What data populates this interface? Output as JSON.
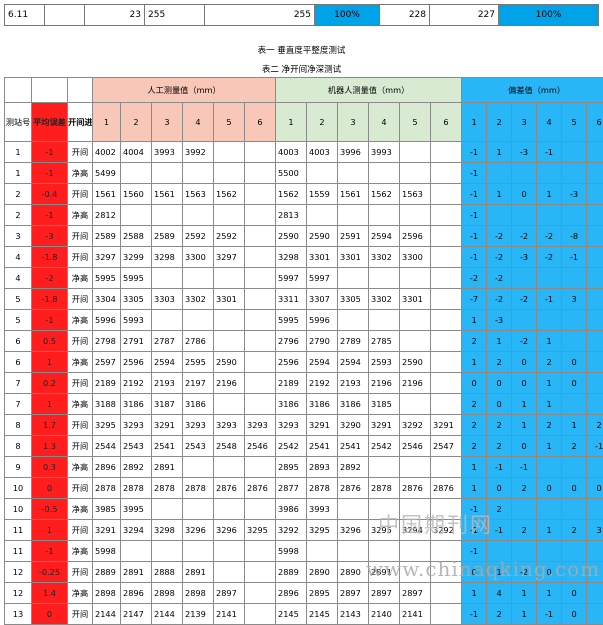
{
  "top_row": [
    "6.11",
    "",
    "23",
    "255",
    "255",
    "100%",
    "228",
    "227",
    "100%"
  ],
  "marks": {
    "center": "",
    "right": "",
    "cell": ""
  },
  "captions": [
    "表一 垂直度平整度测试",
    "表二 净开间净深测试"
  ],
  "header": {
    "manual": "人工测量值（mm）",
    "robot": "机器人测量值（mm）",
    "dev": "偏差值（mm）",
    "station": "测站号",
    "avgdev": "平均误差",
    "type": "开间进深",
    "idx": [
      "1",
      "2",
      "3",
      "4",
      "5",
      "6"
    ]
  },
  "rows": [
    {
      "s": "1",
      "d": "-1",
      "t": "开间",
      "m": [
        "4002",
        "4004",
        "3993",
        "3992",
        "",
        ""
      ],
      "r": [
        "4003",
        "4003",
        "3996",
        "3993",
        "",
        ""
      ],
      "dv": [
        "-1",
        "1",
        "-3",
        "-1",
        "",
        ""
      ]
    },
    {
      "s": "1",
      "d": "-1",
      "t": "净高",
      "m": [
        "5499",
        "",
        "",
        "",
        "",
        ""
      ],
      "r": [
        "5500",
        "",
        "",
        "",
        "",
        ""
      ],
      "dv": [
        "-1",
        "",
        "",
        "",
        "",
        ""
      ]
    },
    {
      "s": "2",
      "d": "-0.4",
      "t": "开间",
      "m": [
        "1561",
        "1560",
        "1561",
        "1563",
        "1562",
        ""
      ],
      "r": [
        "1562",
        "1559",
        "1561",
        "1562",
        "1563",
        ""
      ],
      "dv": [
        "-1",
        "1",
        "0",
        "1",
        "-3",
        ""
      ]
    },
    {
      "s": "2",
      "d": "-1",
      "t": "净高",
      "m": [
        "2812",
        "",
        "",
        "",
        "",
        ""
      ],
      "r": [
        "2813",
        "",
        "",
        "",
        "",
        ""
      ],
      "dv": [
        "-1",
        "",
        "",
        "",
        "",
        ""
      ]
    },
    {
      "s": "3",
      "d": "-3",
      "t": "开间",
      "m": [
        "2589",
        "2588",
        "2589",
        "2592",
        "2592",
        ""
      ],
      "r": [
        "2590",
        "2590",
        "2591",
        "2594",
        "2596",
        ""
      ],
      "dv": [
        "-1",
        "-2",
        "-2",
        "-2",
        "-8",
        ""
      ]
    },
    {
      "s": "4",
      "d": "-1.8",
      "t": "开间",
      "m": [
        "3297",
        "3299",
        "3298",
        "3300",
        "3297",
        ""
      ],
      "r": [
        "3298",
        "3301",
        "3301",
        "3302",
        "3300",
        ""
      ],
      "dv": [
        "-1",
        "-2",
        "-3",
        "-2",
        "-1",
        ""
      ]
    },
    {
      "s": "4",
      "d": "-2",
      "t": "净高",
      "m": [
        "5995",
        "5995",
        "",
        "",
        "",
        ""
      ],
      "r": [
        "5997",
        "5997",
        "",
        "",
        "",
        ""
      ],
      "dv": [
        "-2",
        "-2",
        "",
        "",
        "",
        ""
      ]
    },
    {
      "s": "5",
      "d": "-1.8",
      "t": "开间",
      "m": [
        "3304",
        "3305",
        "3303",
        "3302",
        "3301",
        ""
      ],
      "r": [
        "3311",
        "3307",
        "3305",
        "3302",
        "3301",
        ""
      ],
      "dv": [
        "-7",
        "-2",
        "-2",
        "-1",
        "3",
        ""
      ]
    },
    {
      "s": "5",
      "d": "-1",
      "t": "净高",
      "m": [
        "5996",
        "5993",
        "",
        "",
        "",
        ""
      ],
      "r": [
        "5995",
        "5996",
        "",
        "",
        "",
        ""
      ],
      "dv": [
        "1",
        "-3",
        "",
        "",
        "",
        ""
      ]
    },
    {
      "s": "6",
      "d": "0.5",
      "t": "开间",
      "m": [
        "2798",
        "2791",
        "2787",
        "2786",
        "",
        ""
      ],
      "r": [
        "2796",
        "2790",
        "2789",
        "2785",
        "",
        ""
      ],
      "dv": [
        "2",
        "1",
        "-2",
        "1",
        "",
        ""
      ]
    },
    {
      "s": "6",
      "d": "1",
      "t": "净高",
      "m": [
        "2597",
        "2596",
        "2594",
        "2595",
        "2590",
        ""
      ],
      "r": [
        "2596",
        "2594",
        "2594",
        "2593",
        "2590",
        ""
      ],
      "dv": [
        "1",
        "2",
        "0",
        "2",
        "0",
        ""
      ]
    },
    {
      "s": "7",
      "d": "0.2",
      "t": "开间",
      "m": [
        "2189",
        "2192",
        "2193",
        "2197",
        "2196",
        ""
      ],
      "r": [
        "2189",
        "2192",
        "2193",
        "2196",
        "2196",
        ""
      ],
      "dv": [
        "0",
        "0",
        "0",
        "1",
        "0",
        ""
      ]
    },
    {
      "s": "7",
      "d": "1",
      "t": "净高",
      "m": [
        "3188",
        "3186",
        "3187",
        "3186",
        "",
        ""
      ],
      "r": [
        "3186",
        "3186",
        "3186",
        "3185",
        "",
        ""
      ],
      "dv": [
        "2",
        "0",
        "1",
        "1",
        "",
        ""
      ]
    },
    {
      "s": "8",
      "d": "1.7",
      "t": "开间",
      "m": [
        "3295",
        "3293",
        "3291",
        "3293",
        "3293",
        "3293"
      ],
      "r": [
        "3293",
        "3291",
        "3290",
        "3291",
        "3292",
        "3291"
      ],
      "dv": [
        "2",
        "2",
        "1",
        "2",
        "1",
        "2"
      ]
    },
    {
      "s": "8",
      "d": "1.3",
      "t": "开间",
      "m": [
        "2544",
        "2543",
        "2541",
        "2543",
        "2548",
        "2546"
      ],
      "r": [
        "2542",
        "2541",
        "2541",
        "2542",
        "2546",
        "2547"
      ],
      "dv": [
        "2",
        "2",
        "0",
        "1",
        "2",
        "-1"
      ]
    },
    {
      "s": "9",
      "d": "0.3",
      "t": "净高",
      "m": [
        "2896",
        "2892",
        "2891",
        "",
        "",
        ""
      ],
      "r": [
        "2895",
        "2893",
        "2892",
        "",
        "",
        ""
      ],
      "dv": [
        "1",
        "-1",
        "-1",
        "",
        "",
        ""
      ]
    },
    {
      "s": "10",
      "d": "0",
      "t": "开间",
      "m": [
        "2878",
        "2878",
        "2878",
        "2878",
        "2876",
        "2876"
      ],
      "r": [
        "2877",
        "2878",
        "2876",
        "2878",
        "2876",
        "2876"
      ],
      "dv": [
        "1",
        "0",
        "2",
        "0",
        "0",
        "0"
      ]
    },
    {
      "s": "10",
      "d": "-0.5",
      "t": "净高",
      "m": [
        "3985",
        "3995",
        "",
        "",
        "",
        ""
      ],
      "r": [
        "3986",
        "3993",
        "",
        "",
        "",
        ""
      ],
      "dv": [
        "-1",
        "2",
        "",
        "",
        "",
        ""
      ]
    },
    {
      "s": "11",
      "d": "1",
      "t": "开间",
      "m": [
        "3291",
        "3294",
        "3298",
        "3296",
        "3296",
        "3295"
      ],
      "r": [
        "3292",
        "3295",
        "3296",
        "3295",
        "3294",
        "3292"
      ],
      "dv": [
        "-1",
        "-1",
        "2",
        "1",
        "2",
        "3"
      ]
    },
    {
      "s": "11",
      "d": "-1",
      "t": "净高",
      "m": [
        "5998",
        "",
        "",
        "",
        "",
        ""
      ],
      "r": [
        "5998",
        "",
        "",
        "",
        "",
        ""
      ],
      "dv": [
        "-1",
        "",
        "",
        "",
        "",
        ""
      ]
    },
    {
      "s": "12",
      "d": "-0.25",
      "t": "开间",
      "m": [
        "2889",
        "2891",
        "2888",
        "2891",
        "",
        ""
      ],
      "r": [
        "2889",
        "2890",
        "2890",
        "2891",
        "",
        ""
      ],
      "dv": [
        "0",
        "1",
        "-2",
        "0",
        "",
        ""
      ]
    },
    {
      "s": "12",
      "d": "1.4",
      "t": "净高",
      "m": [
        "2898",
        "2896",
        "2898",
        "2898",
        "2897",
        ""
      ],
      "r": [
        "2896",
        "2895",
        "2897",
        "2897",
        "2897",
        ""
      ],
      "dv": [
        "1",
        "4",
        "1",
        "1",
        "0",
        ""
      ]
    },
    {
      "s": "13",
      "d": "0",
      "t": "开间",
      "m": [
        "2144",
        "2147",
        "2144",
        "2139",
        "2141",
        ""
      ],
      "r": [
        "2145",
        "2145",
        "2143",
        "2140",
        "2141",
        ""
      ],
      "dv": [
        "-1",
        "2",
        "1",
        "-1",
        "0",
        ""
      ]
    }
  ],
  "watermark": [
    "中国期刊网",
    "www.chinaqking.com"
  ]
}
